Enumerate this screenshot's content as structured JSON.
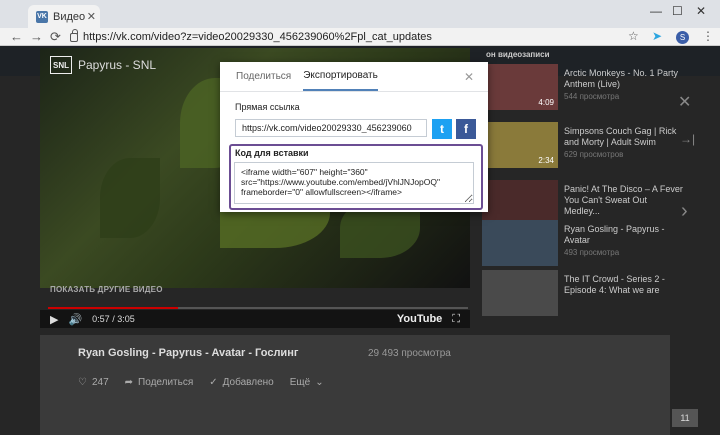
{
  "browser": {
    "tab_title": "Видео",
    "tab_logo": "VK",
    "url": "https://vk.com/video?z=video20029330_456239060%2Fpl_cat_updates",
    "profile_initial": "S"
  },
  "video": {
    "logo": "SNL",
    "title": "Papyrus - SNL",
    "other_videos_label": "ПОКАЗАТЬ ДРУГИЕ ВИДЕО",
    "time": "0:57 / 3:05",
    "progress_fraction": 0.31,
    "provider": "YouTube"
  },
  "sidebar": {
    "header": "он видеозаписи",
    "items": [
      {
        "title": "Arctic Monkeys - No. 1 Party Anthem (Live)",
        "views": "544 просмотра",
        "duration": "4:09",
        "thumb": "#6a3a3a"
      },
      {
        "title": "Simpsons Couch Gag | Rick and Morty | Adult Swim",
        "views": "629 просмотров",
        "duration": "2:34",
        "thumb": "#8a7a3a"
      },
      {
        "title": "Panic! At The Disco – A Fever You Can't Sweat Out Medley...",
        "views": "",
        "duration": "",
        "thumb": "#4a2a2a"
      },
      {
        "title": "Ryan Gosling - Papyrus - Avatar",
        "views": "493 просмотра",
        "duration": "",
        "thumb": "#3a4a5a"
      },
      {
        "title": "The IT Crowd - Series 2 - Episode 4: What we are",
        "views": "",
        "duration": "",
        "thumb": "#4a4a4a"
      }
    ]
  },
  "below": {
    "title": "Ryan Gosling - Papyrus - Avatar - Гослинг",
    "views": "29 493 просмотра",
    "likes": "247",
    "share": "Поделиться",
    "added": "Добавлено",
    "more": "Ещё"
  },
  "badge": "11",
  "modal": {
    "tab_share": "Поделиться",
    "tab_export": "Экспортировать",
    "direct_link_label": "Прямая ссылка",
    "direct_link_value": "https://vk.com/video20029330_456239060",
    "embed_label": "Код для вставки",
    "embed_code": "<iframe width=\"607\" height=\"360\" src=\"https://www.youtube.com/embed/jVhlJNJopOQ\" frameborder=\"0\" allowfullscreen></iframe>"
  },
  "colors": {
    "twitter": "#1da1f2",
    "facebook": "#3b5998",
    "highlight": "#6b4d93",
    "accent": "#5181b8"
  }
}
